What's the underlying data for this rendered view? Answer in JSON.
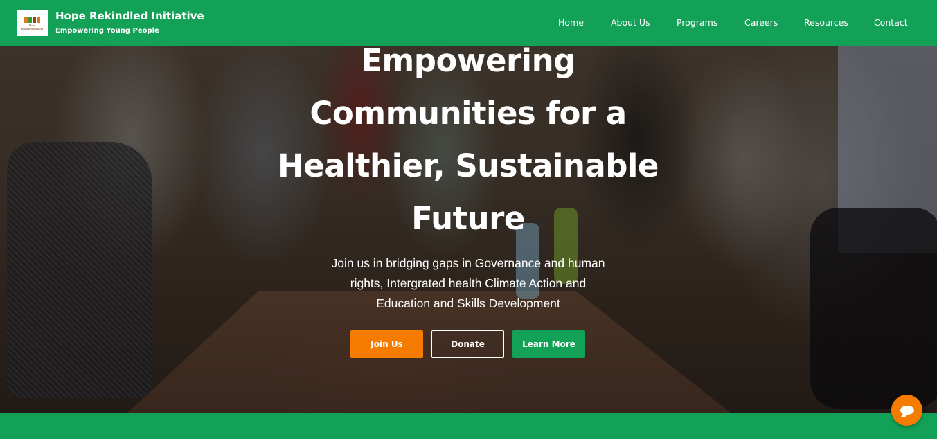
{
  "brand": {
    "title": "Hope Rekindled Initiative",
    "tagline": "Empowering Young People",
    "logo_icon": "people-logo-icon",
    "logo_text_line1": "Hope",
    "logo_text_line2": "Rekindled Initiative"
  },
  "nav": {
    "items": [
      {
        "label": "Home"
      },
      {
        "label": "About Us"
      },
      {
        "label": "Programs"
      },
      {
        "label": "Careers"
      },
      {
        "label": "Resources"
      },
      {
        "label": "Contact"
      }
    ]
  },
  "hero": {
    "title_lines": [
      "Empowering",
      "Communities for a",
      "Healthier, Sustainable",
      "Future"
    ],
    "subtitle_lines": [
      "Join us in bridging gaps in Governance and human",
      "rights, Intergrated health Climate Action and",
      "Education and Skills Development"
    ],
    "buttons": {
      "join": "Join Us",
      "donate": "Donate",
      "learn": "Learn More"
    }
  },
  "chat": {
    "icon": "chat-bubble-icon"
  },
  "colors": {
    "primary_green": "#13a157",
    "accent_orange": "#f57c00",
    "text_white": "#ffffff"
  }
}
